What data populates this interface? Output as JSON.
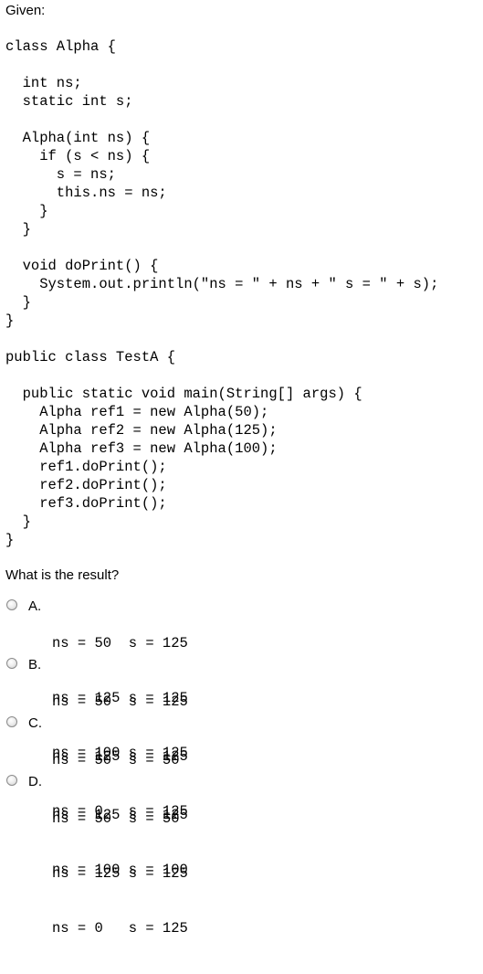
{
  "given_label": "Given:",
  "code_lines": [
    "class Alpha {",
    "",
    "  int ns;",
    "  static int s;",
    "",
    "  Alpha(int ns) {",
    "    if (s < ns) {",
    "      s = ns;",
    "      this.ns = ns;",
    "    }",
    "  }",
    "",
    "  void doPrint() {",
    "    System.out.println(\"ns = \" + ns + \" s = \" + s);",
    "  }",
    "}",
    "",
    "public class TestA {",
    "",
    "  public static void main(String[] args) {",
    "    Alpha ref1 = new Alpha(50);",
    "    Alpha ref2 = new Alpha(125);",
    "    Alpha ref3 = new Alpha(100);",
    "    ref1.doPrint();",
    "    ref2.doPrint();",
    "    ref3.doPrint();",
    "  }",
    "}"
  ],
  "question": "What is the result?",
  "options": [
    {
      "letter": "A.",
      "lines": [
        "ns = 50  s = 125",
        "ns = 125 s = 125",
        "ns = 100 s = 125"
      ]
    },
    {
      "letter": "B.",
      "lines": [
        "ns = 50  s = 125",
        "ns = 125 s = 125",
        "ns = 0   s = 125"
      ]
    },
    {
      "letter": "C.",
      "lines": [
        "ns = 50  s = 50",
        "ns = 125 s = 125",
        "ns = 100 s = 100"
      ]
    },
    {
      "letter": "D.",
      "lines": [
        "ns = 50  s = 50",
        "ns = 125 s = 125",
        "ns = 0   s = 125"
      ]
    }
  ]
}
